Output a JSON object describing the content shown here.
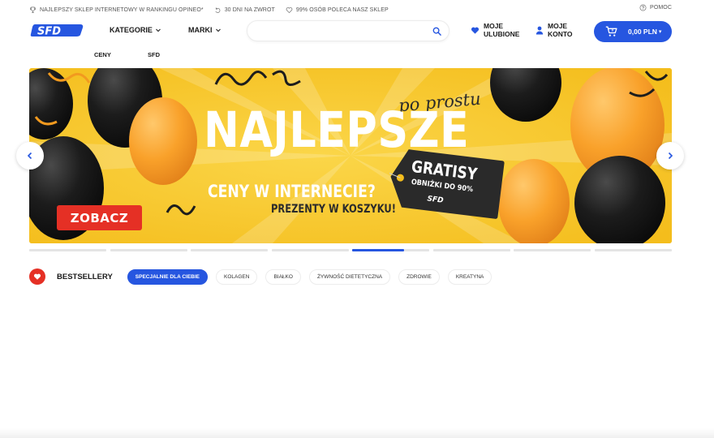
{
  "topbar": {
    "items": [
      {
        "icon": "trophy-icon",
        "label": "NAJLEPSZY SKLEP INTERNETOWY W RANKINGU OPINEO*"
      },
      {
        "icon": "return-icon",
        "label": "30 DNI NA ZWROT"
      },
      {
        "icon": "heart-outline-icon",
        "label": "99% OSÓB POLECA NASZ SKLEP"
      }
    ],
    "help": {
      "icon": "help-circle-icon",
      "label": "POMOC"
    }
  },
  "header": {
    "logo": "SFD",
    "nav": [
      {
        "label": "KATEGORIE"
      },
      {
        "label": "MARKI"
      }
    ],
    "search": {
      "placeholder": "",
      "value": "",
      "icon": "search-icon"
    },
    "favorites": {
      "line1": "MOJE",
      "line2": "ULUBIONE",
      "icon": "heart-icon"
    },
    "account": {
      "line1": "MOJE",
      "line2": "KONTO",
      "icon": "user-icon"
    },
    "cart": {
      "label": "0,00 PLN",
      "icon": "cart-icon",
      "color": "#2656e0"
    }
  },
  "subnav": [
    {
      "label": "CENY"
    },
    {
      "label": "SFD"
    }
  ],
  "banner": {
    "script": "po prostu",
    "title": "NAJLEPSZE",
    "subtitle": "CENY W INTERNECIE?",
    "subtitle2": "PREZENTY W KOSZYKU!",
    "tag_title": "GRATISY",
    "tag_sub": "OBNIŻKI DO 90%",
    "tag_logo": "SFD",
    "cta": "ZOBACZ",
    "colors": {
      "background": "#f7c523",
      "cta": "#e53025"
    }
  },
  "slider": {
    "count": 8,
    "active_index": 4,
    "prev_icon": "chevron-left-icon",
    "next_icon": "chevron-right-icon"
  },
  "bestsellers": {
    "title": "BESTSELLERY",
    "icon": "heart-icon",
    "tabs": [
      {
        "label": "SPECJALNIE DLA CIEBIE",
        "active": true
      },
      {
        "label": "KOLAGEN",
        "active": false
      },
      {
        "label": "BIAŁKO",
        "active": false
      },
      {
        "label": "ŻYWNOŚĆ DIETETYCZNA",
        "active": false
      },
      {
        "label": "ZDROWIE",
        "active": false
      },
      {
        "label": "KREATYNA",
        "active": false
      }
    ]
  },
  "colors": {
    "accent": "#2656e0",
    "red": "#e53025"
  }
}
